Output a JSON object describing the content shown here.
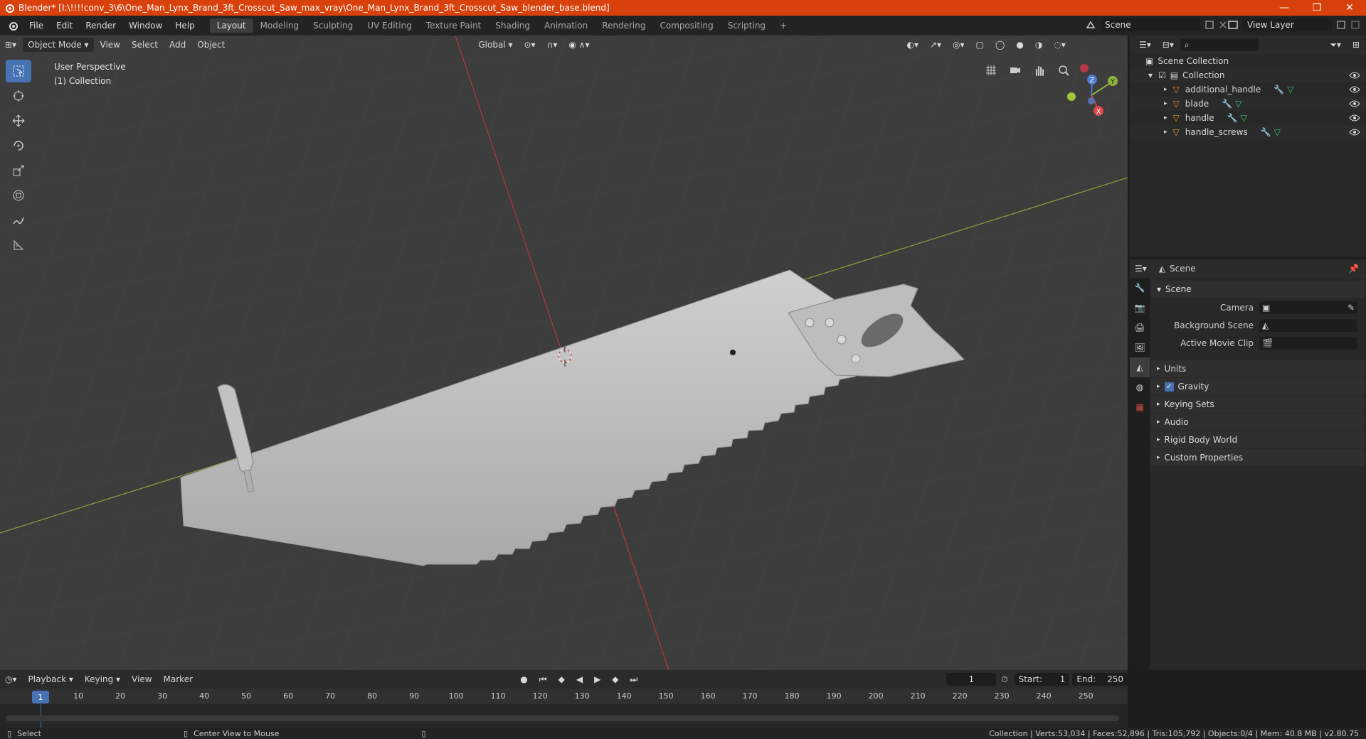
{
  "window": {
    "title": "Blender* [I:\\!!!!conv_3\\6\\One_Man_Lynx_Brand_3ft_Crosscut_Saw_max_vray\\One_Man_Lynx_Brand_3ft_Crosscut_Saw_blender_base.blend]",
    "minimize": "—",
    "maximize": "❐",
    "close": "✕"
  },
  "menu": [
    "File",
    "Edit",
    "Render",
    "Window",
    "Help"
  ],
  "workspaces": [
    "Layout",
    "Modeling",
    "Sculpting",
    "UV Editing",
    "Texture Paint",
    "Shading",
    "Animation",
    "Rendering",
    "Compositing",
    "Scripting",
    "+"
  ],
  "active_workspace": "Layout",
  "scene_selector": {
    "label": "Scene"
  },
  "viewlayer_selector": {
    "label": "View Layer"
  },
  "viewport": {
    "mode": "Object Mode",
    "menus": [
      "View",
      "Select",
      "Add",
      "Object"
    ],
    "orientation": "Global",
    "overlay_line1": "User Perspective",
    "overlay_line2": "(1) Collection"
  },
  "outliner": {
    "root": "Scene Collection",
    "collection": "Collection",
    "objects": [
      {
        "name": "additional_handle"
      },
      {
        "name": "blade"
      },
      {
        "name": "handle"
      },
      {
        "name": "handle_screws"
      }
    ]
  },
  "properties": {
    "header": "Scene",
    "panel_title": "Scene",
    "fields": [
      {
        "label": "Camera",
        "value": ""
      },
      {
        "label": "Background Scene",
        "value": ""
      },
      {
        "label": "Active Movie Clip",
        "value": ""
      }
    ],
    "sections": [
      {
        "label": "Units",
        "checkbox": false
      },
      {
        "label": "Gravity",
        "checkbox": true
      },
      {
        "label": "Keying Sets",
        "checkbox": false
      },
      {
        "label": "Audio",
        "checkbox": false
      },
      {
        "label": "Rigid Body World",
        "checkbox": false
      },
      {
        "label": "Custom Properties",
        "checkbox": false
      }
    ]
  },
  "timeline": {
    "menus": [
      "Playback",
      "Keying",
      "View",
      "Marker"
    ],
    "current_frame": "1",
    "start_label": "Start:",
    "start": "1",
    "end_label": "End:",
    "end": "250",
    "ticks": [
      "1",
      "10",
      "20",
      "30",
      "40",
      "50",
      "60",
      "70",
      "80",
      "90",
      "100",
      "110",
      "120",
      "130",
      "140",
      "150",
      "160",
      "170",
      "180",
      "190",
      "200",
      "210",
      "220",
      "230",
      "240",
      "250"
    ]
  },
  "statusbar": {
    "left1": "Select",
    "left2": "Center View to Mouse",
    "right": "Collection | Verts:53,034 | Faces:52,896 | Tris:105,792 | Objects:0/4 | Mem: 40.8 MB | v2.80.75"
  },
  "colors": {
    "title_bar": "#d9410c",
    "viewport_bg": "#3d3d3d",
    "accent_blue": "#4772b3",
    "axis_x": "#c43a3a",
    "axis_y": "#7ea13a"
  }
}
